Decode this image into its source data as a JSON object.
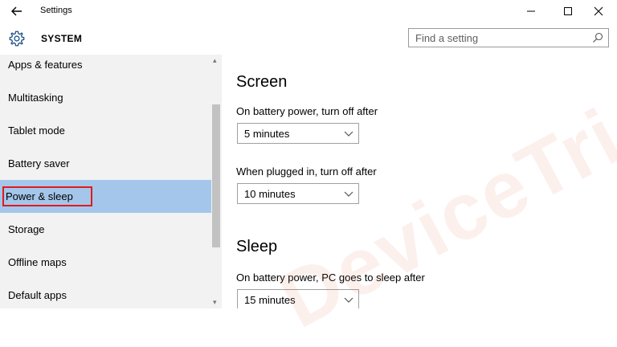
{
  "window": {
    "title": "Settings",
    "back_icon": "back-arrow-icon",
    "minimize_icon": "minimize-icon",
    "maximize_icon": "maximize-icon",
    "close_icon": "close-icon"
  },
  "header": {
    "icon": "gear-icon",
    "title": "SYSTEM"
  },
  "search": {
    "placeholder": "Find a setting",
    "icon": "search-icon"
  },
  "sidebar": {
    "items": [
      {
        "label": "Apps & features"
      },
      {
        "label": "Multitasking"
      },
      {
        "label": "Tablet mode"
      },
      {
        "label": "Battery saver"
      },
      {
        "label": "Power & sleep",
        "selected": true
      },
      {
        "label": "Storage"
      },
      {
        "label": "Offline maps"
      },
      {
        "label": "Default apps"
      }
    ],
    "selected_color": "#a4c6ea",
    "highlight_box_color": "#e01b1b"
  },
  "content": {
    "screen": {
      "title": "Screen",
      "battery_label": "On battery power, turn off after",
      "battery_value": "5 minutes",
      "plugged_label": "When plugged in, turn off after",
      "plugged_value": "10 minutes"
    },
    "sleep": {
      "title": "Sleep",
      "battery_label": "On battery power, PC goes to sleep after",
      "battery_value": "15 minutes"
    }
  },
  "watermark": "DeviceTricks"
}
